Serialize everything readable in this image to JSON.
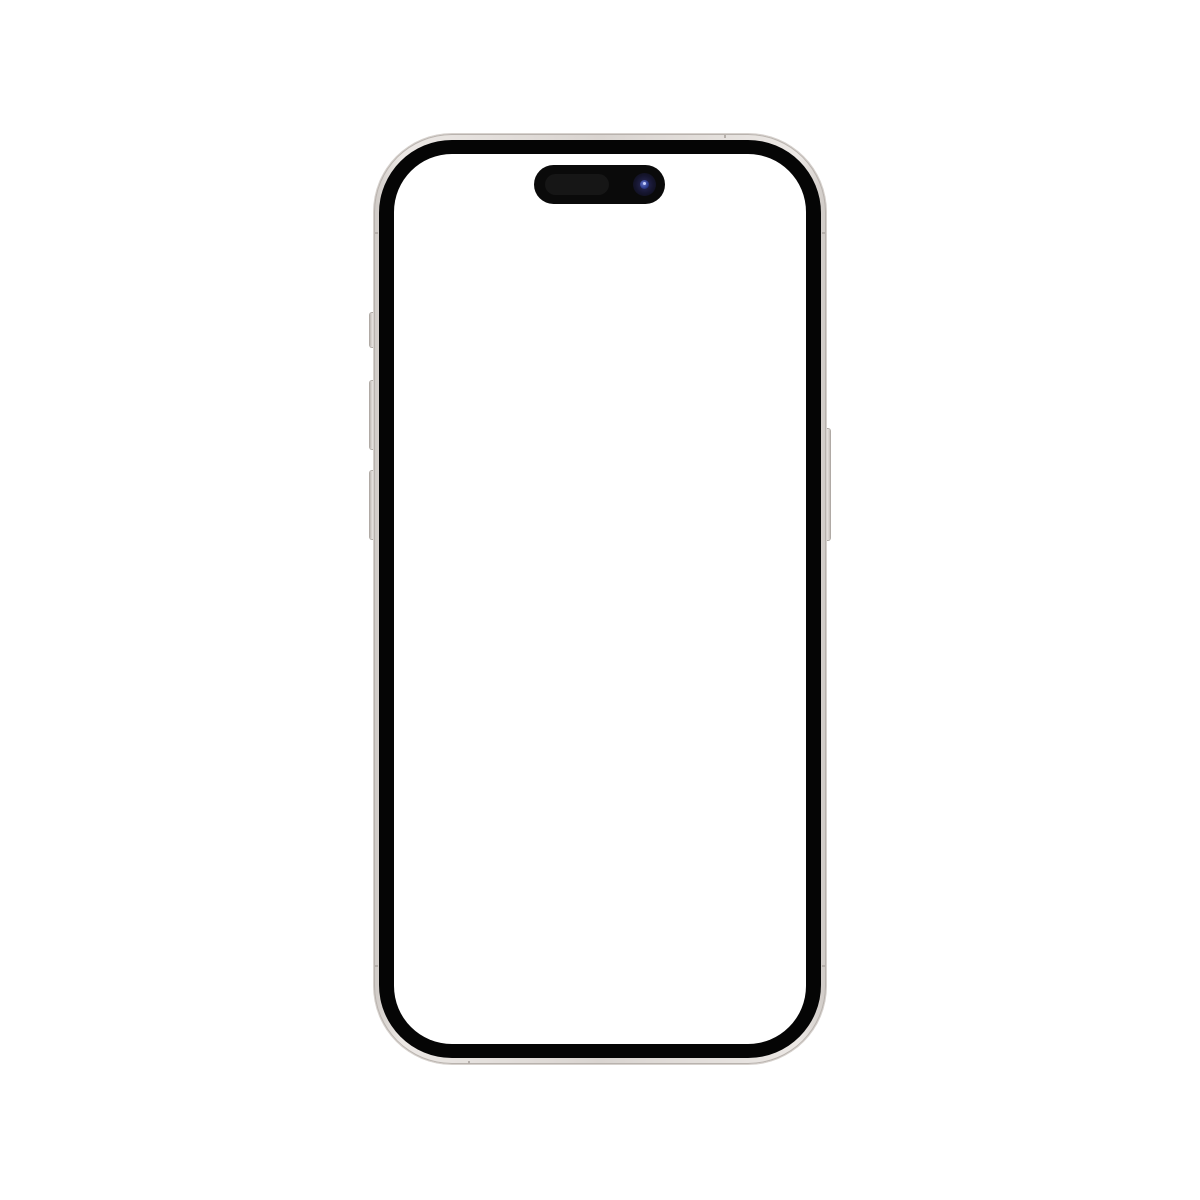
{
  "device": {
    "frame_color": "#d9d4d0",
    "bezel_color": "#050505",
    "screen_color": "#ffffff",
    "camera_color": "#2b3a8a",
    "icons": [
      "dynamic-island",
      "front-camera-icon"
    ]
  }
}
